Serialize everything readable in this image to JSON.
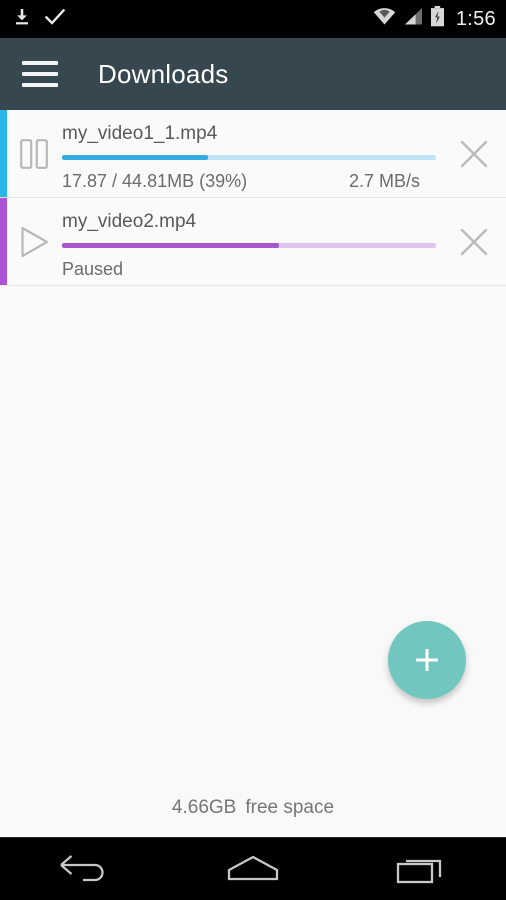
{
  "status_bar": {
    "left_icons": [
      "download-icon",
      "check-icon"
    ],
    "right_icons": [
      "wifi-icon",
      "cellular-signal-icon",
      "battery-charging-icon"
    ],
    "time": "1:56"
  },
  "app_bar": {
    "menu_icon": "hamburger-menu-icon",
    "title": "Downloads"
  },
  "downloads": [
    {
      "filename": "my_video1_1.mp4",
      "control_icon": "pause-icon",
      "accent_color": "#29B6E8",
      "progress_fill_color": "#35ADE3",
      "progress_track_color": "#BFE4F5",
      "progress_percent": 39,
      "stats": "17.87 / 44.81MB (39%)",
      "speed": "2.7 MB/s",
      "cancel_icon": "close-icon"
    },
    {
      "filename": "my_video2.mp4",
      "control_icon": "play-icon",
      "accent_color": "#AB52D5",
      "progress_fill_color": "#A757CE",
      "progress_track_color": "#E0C5EC",
      "progress_percent": 58,
      "stats": "Paused",
      "speed": "",
      "cancel_icon": "close-icon"
    }
  ],
  "fab": {
    "icon": "plus-icon",
    "color": "#71C7BF"
  },
  "footer": {
    "free_space_value": "4.66GB",
    "free_space_label": "free space"
  },
  "nav_bar": {
    "back_icon": "back-arrow-icon",
    "home_icon": "home-icon",
    "recents_icon": "recents-icon"
  }
}
